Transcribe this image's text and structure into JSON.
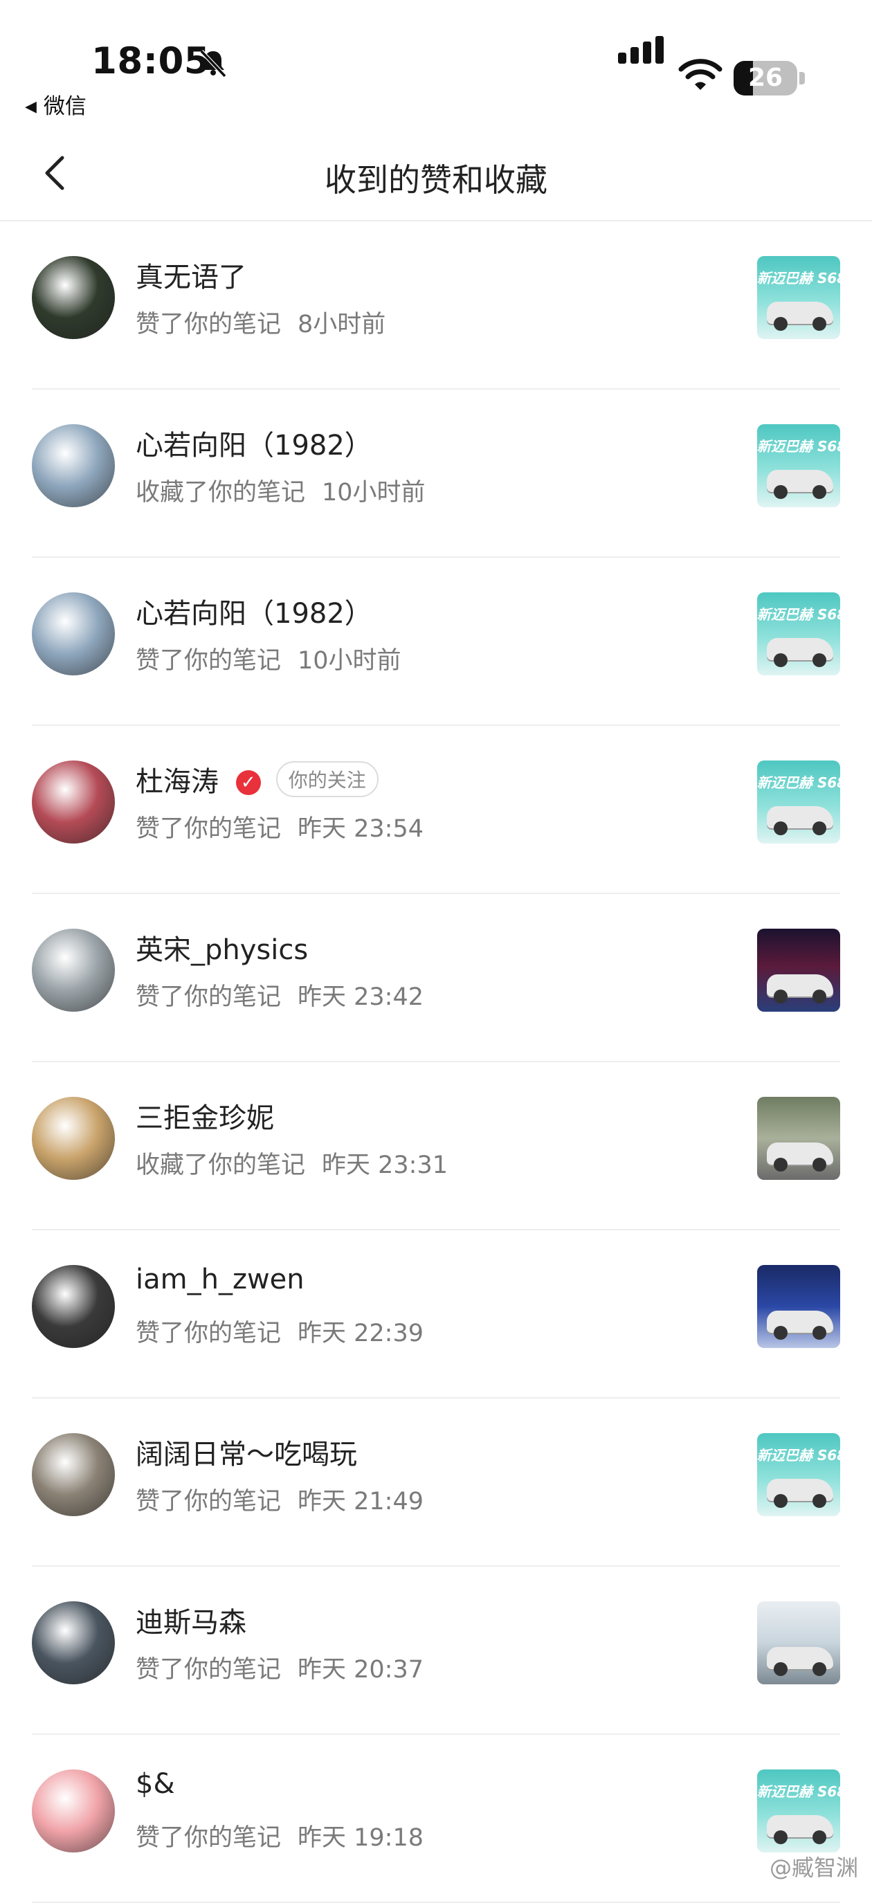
{
  "status": {
    "time": "18:05",
    "back_app": "微信",
    "battery": "26"
  },
  "nav": {
    "title": "收到的赞和收藏"
  },
  "items": [
    {
      "name": "真无语了",
      "action": "赞了你的笔记",
      "time": "8小时前",
      "avatar_color": "#2f3a2c",
      "thumb_style": "teal",
      "thumb_label": "新迈巴赫 S68"
    },
    {
      "name": "心若向阳（1982）",
      "action": "收藏了你的笔记",
      "time": "10小时前",
      "avatar_color": "#8fa7bd",
      "thumb_style": "teal",
      "thumb_label": "新迈巴赫 S68"
    },
    {
      "name": "心若向阳（1982）",
      "action": "赞了你的笔记",
      "time": "10小时前",
      "avatar_color": "#8fa7bd",
      "thumb_style": "teal",
      "thumb_label": "新迈巴赫 S68"
    },
    {
      "name": "杜海涛",
      "verified": true,
      "tag": "你的关注",
      "action": "赞了你的笔记",
      "time": "昨天 23:54",
      "avatar_color": "#b44b56",
      "thumb_style": "teal",
      "thumb_label": "新迈巴赫 S68"
    },
    {
      "name": "英宋_physics",
      "action": "赞了你的笔记",
      "time": "昨天 23:42",
      "avatar_color": "#9aa3a8",
      "thumb_style": "stage",
      "thumb_label": ""
    },
    {
      "name": "三拒金珍妮",
      "action": "收藏了你的笔记",
      "time": "昨天 23:31",
      "avatar_color": "#c9a36b",
      "thumb_style": "outdoor",
      "thumb_label": ""
    },
    {
      "name": "iam_h_zwen",
      "action": "赞了你的笔记",
      "time": "昨天 22:39",
      "avatar_color": "#3a3a3a",
      "thumb_style": "event",
      "thumb_label": ""
    },
    {
      "name": "阔阔日常～吃喝玩",
      "action": "赞了你的笔记",
      "time": "昨天 21:49",
      "avatar_color": "#8b8275",
      "thumb_style": "teal",
      "thumb_label": "新迈巴赫 S68"
    },
    {
      "name": "迪斯马森",
      "action": "赞了你的笔记",
      "time": "昨天 20:37",
      "avatar_color": "#4a5560",
      "thumb_style": "coast",
      "thumb_label": ""
    },
    {
      "name": "$&",
      "action": "赞了你的笔记",
      "time": "昨天 19:18",
      "avatar_color": "#f0a3a8",
      "thumb_style": "teal",
      "thumb_label": "新迈巴赫 S68"
    }
  ],
  "watermark": "@臧智渊"
}
